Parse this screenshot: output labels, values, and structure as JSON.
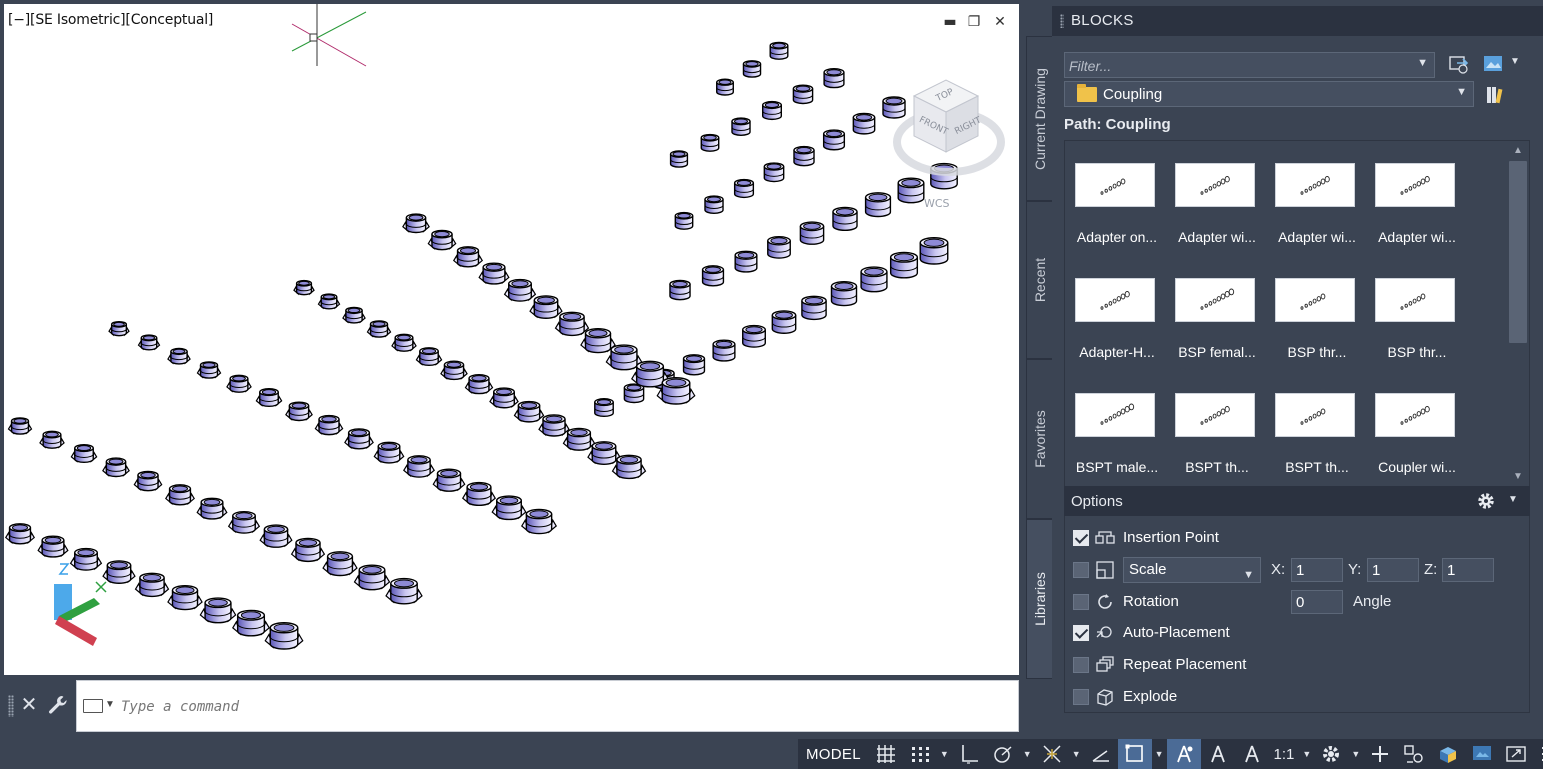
{
  "viewport": {
    "label": "[−][SE Isometric][Conceptual]",
    "controls": {
      "minimize": "▬",
      "restore": "❐",
      "close": "✕"
    },
    "viewcube": {
      "top": "TOP",
      "front": "FRONT",
      "right": "RIGHT",
      "wcs": "WCS"
    }
  },
  "command_line": {
    "close_glyph": "✕",
    "placeholder": "Type a command"
  },
  "statusbar": {
    "model": "MODEL",
    "scale": "1:1",
    "items": [
      "grid-icon",
      "snap-icon",
      "ortho-icon",
      "polar-icon",
      "osnap-icon",
      "lineweight-icon",
      "transparency-icon",
      "annotation-visibility-icon",
      "autoscale-icon",
      "annotation-scale-icon",
      "gear-icon",
      "plus-icon",
      "workspace-icon",
      "isolate-icon",
      "hardware-accel-icon",
      "fullscreen-icon",
      "menu-icon"
    ]
  },
  "palette": {
    "title": "BLOCKS",
    "tabs": [
      "Current Drawing",
      "Recent",
      "Favorites",
      "Libraries"
    ],
    "active_tab": "Libraries",
    "filter_placeholder": "Filter...",
    "folder": "Coupling",
    "path": "Path: Coupling",
    "blocks": [
      {
        "label": "Adapter on...",
        "dots": 6
      },
      {
        "label": "Adapter wi...",
        "dots": 7
      },
      {
        "label": "Adapter wi...",
        "dots": 7
      },
      {
        "label": "Adapter wi...",
        "dots": 7
      },
      {
        "label": "Adapter-H...",
        "dots": 7
      },
      {
        "label": "BSP femal...",
        "dots": 8
      },
      {
        "label": "BSP thr...",
        "dots": 6
      },
      {
        "label": "BSP thr...",
        "dots": 6
      },
      {
        "label": "BSPT male...",
        "dots": 8
      },
      {
        "label": "BSPT th...",
        "dots": 7
      },
      {
        "label": "BSPT th...",
        "dots": 6
      },
      {
        "label": "Coupler wi...",
        "dots": 7
      }
    ],
    "options": {
      "title": "Options",
      "insertion_point": {
        "label": "Insertion Point",
        "checked": true
      },
      "scale": {
        "mode": "Scale",
        "checked": false,
        "x_label": "X:",
        "x": "1",
        "y_label": "Y:",
        "y": "1",
        "z_label": "Z:",
        "z": "1"
      },
      "rotation": {
        "label": "Rotation",
        "checked": false,
        "angle": "0",
        "angle_label": "Angle"
      },
      "auto_placement": {
        "label": "Auto-Placement",
        "checked": true
      },
      "repeat_placement": {
        "label": "Repeat Placement",
        "checked": false
      },
      "explode": {
        "label": "Explode",
        "checked": false
      }
    }
  },
  "colors": {
    "panel_bg": "#3b4453",
    "titlebar_bg": "#2b3240",
    "fitting_fill": "#c9c6f0",
    "fitting_shade": "#5b57b8",
    "accent_active": "#4b6b96"
  }
}
